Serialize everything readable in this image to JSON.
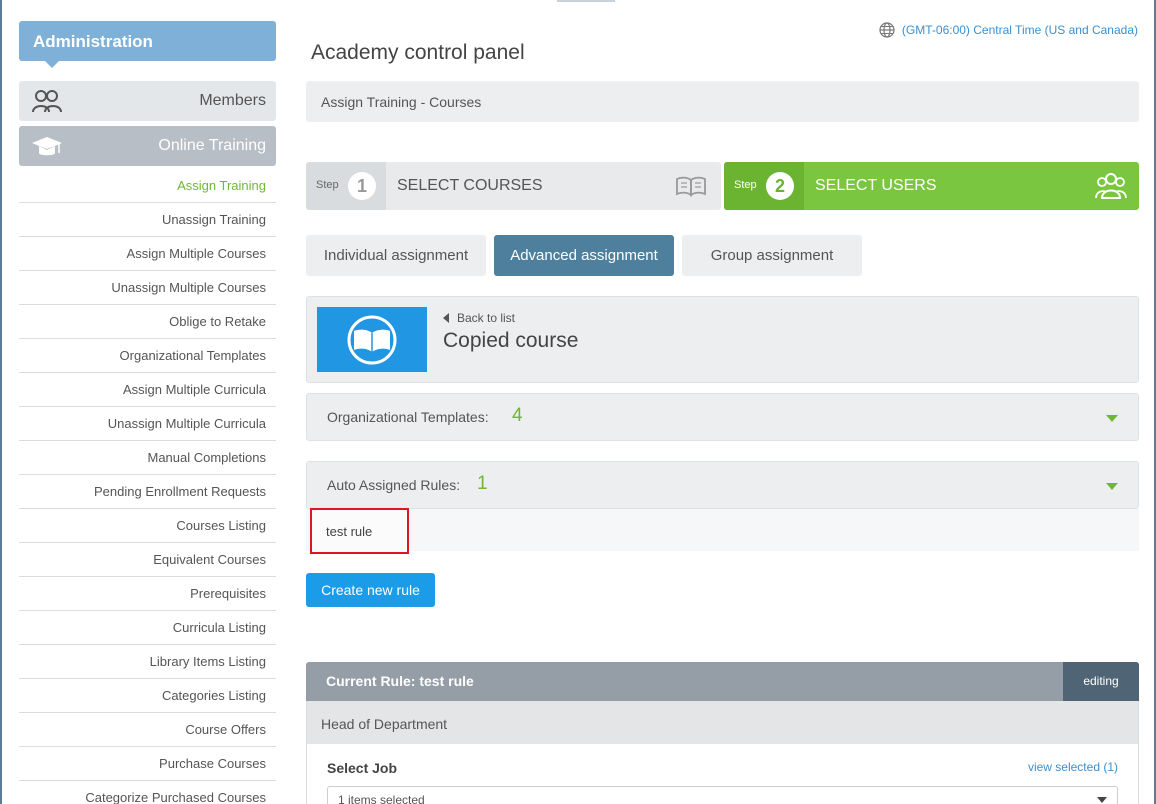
{
  "sidebar": {
    "header": "Administration",
    "members_label": "Members",
    "online_training_label": "Online Training",
    "items": [
      {
        "label": "Assign Training",
        "active": true
      },
      {
        "label": "Unassign Training"
      },
      {
        "label": "Assign Multiple Courses"
      },
      {
        "label": "Unassign Multiple Courses"
      },
      {
        "label": "Oblige to Retake"
      },
      {
        "label": "Organizational Templates"
      },
      {
        "label": "Assign Multiple Curricula"
      },
      {
        "label": "Unassign Multiple Curricula"
      },
      {
        "label": "Manual Completions"
      },
      {
        "label": "Pending Enrollment Requests"
      },
      {
        "label": "Courses Listing"
      },
      {
        "label": "Equivalent Courses"
      },
      {
        "label": "Prerequisites"
      },
      {
        "label": "Curricula Listing"
      },
      {
        "label": "Library Items Listing"
      },
      {
        "label": "Categories Listing"
      },
      {
        "label": "Course Offers"
      },
      {
        "label": "Purchase Courses"
      },
      {
        "label": "Categorize Purchased Courses"
      }
    ]
  },
  "header": {
    "timezone": "(GMT-06:00) Central Time (US and Canada)",
    "title": "Academy control panel",
    "breadcrumb": "Assign Training - Courses"
  },
  "steps": {
    "step_word": "Step",
    "step1": {
      "number": "1",
      "label": "SELECT COURSES"
    },
    "step2": {
      "number": "2",
      "label": "SELECT USERS"
    }
  },
  "tabs": {
    "individual": "Individual assignment",
    "advanced": "Advanced assignment",
    "group": "Group assignment"
  },
  "course": {
    "back_label": "Back to list",
    "name": "Copied course"
  },
  "org_templates": {
    "label": "Organizational Templates:",
    "count": "4"
  },
  "auto_rules": {
    "label": "Auto Assigned Rules:",
    "count": "1",
    "items": [
      "test rule"
    ]
  },
  "create_rule_label": "Create new rule",
  "current_rule": {
    "title": "Current Rule: test rule",
    "status": "editing",
    "section": "Head of Department",
    "select_job_label": "Select Job",
    "view_selected": "view selected (1)",
    "job_select_value": "1 items selected"
  },
  "colors": {
    "admin_blue": "#7fb0d8",
    "active_green": "#71b735",
    "step2_green": "#7bc640",
    "tab_active": "#4e7f9c",
    "button_blue": "#1b9ce9",
    "highlight_red": "#d9191f"
  }
}
